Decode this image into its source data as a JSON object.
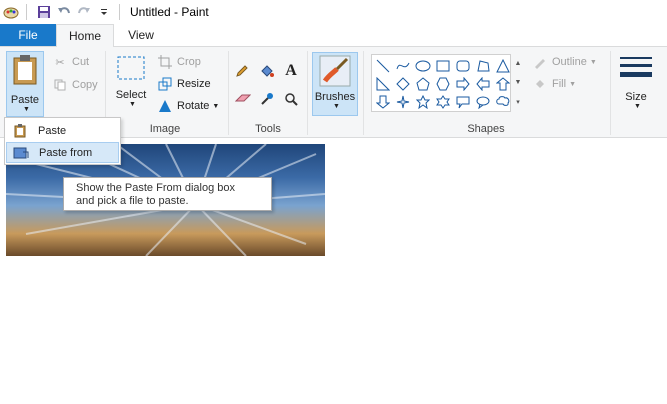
{
  "window": {
    "title": "Untitled - Paint"
  },
  "tabs": {
    "file": "File",
    "home": "Home",
    "view": "View"
  },
  "clipboard": {
    "paste": "Paste",
    "cut": "Cut",
    "copy": "Copy"
  },
  "image_group": {
    "label": "Image",
    "select": "Select",
    "crop": "Crop",
    "resize": "Resize",
    "rotate": "Rotate"
  },
  "tools_group": {
    "label": "Tools"
  },
  "brushes": {
    "label": "Brushes"
  },
  "shapes_group": {
    "label": "Shapes",
    "outline": "Outline",
    "fill": "Fill"
  },
  "size": {
    "label": "Size"
  },
  "paste_menu": {
    "paste": "Paste",
    "paste_from": "Paste from"
  },
  "tooltip": {
    "line1": "Show the Paste From dialog box",
    "line2": "and pick a file to paste."
  },
  "colors": {
    "accent": "#1979ca",
    "ribbon": "#f5f6f7",
    "highlight": "#d6e8f8"
  }
}
